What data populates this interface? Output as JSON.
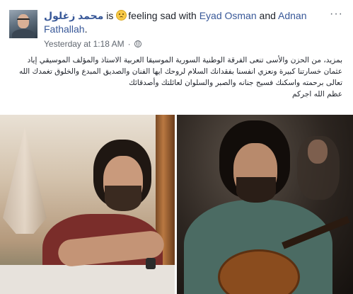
{
  "post": {
    "author": "محمد زغلول",
    "is_text": "is",
    "feeling_text": "feeling sad with",
    "tagged_1": "Eyad Osman",
    "and_text": "and",
    "tagged_2": "Adnan Fathallah",
    "period": ".",
    "timestamp": "Yesterday at 1:18 AM",
    "separator": "·",
    "more_icon": "···",
    "body_lines": [
      "بمزيد، من الحزن والأسى تنعى الفرقة الوطنية السورية الموسيقا العربية الاستاذ والمؤلف الموسيقي إياد",
      "عثمان خسارتنا كبيرة ونعزي انفسنا بفقدانك السلام لروحك ايها الفنان والصديق المبدع والخلوق تغمدك الله",
      "تعالى برحمته واسكنك فسيح جنانه والصبر والسلوان لعائلتك وأصدقائك",
      "عظم الله اجركم"
    ]
  },
  "icons": {
    "emoji": "sad-face-emoji",
    "privacy": "globe-icon",
    "more": "more-icon"
  },
  "colors": {
    "link": "#385898",
    "text": "#1d2129",
    "meta": "#616770"
  }
}
